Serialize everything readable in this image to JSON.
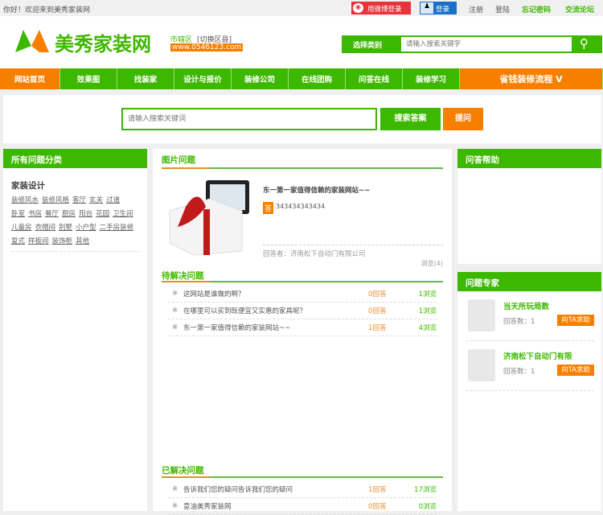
{
  "topbar": {
    "welcome": "你好！欢迎来到美秀家装网",
    "weibo_login": "用微博登录",
    "qq_login": "登录",
    "register": "注册",
    "signin": "登陆",
    "forgot": "忘记密码",
    "forum": "交流论坛"
  },
  "header": {
    "logo": "美秀家装网",
    "city": "市辖区",
    "switch_city": "[切换区县]",
    "url": "www.0546123.com",
    "category_label": "选择类别",
    "search_placeholder": "请输入搜索关键字"
  },
  "nav": [
    "网站首页",
    "效果图",
    "找装家",
    "设计与报价",
    "装修公司",
    "在线团购",
    "问答在线",
    "装修学习"
  ],
  "nav_special": "省钱装修流程 V",
  "search": {
    "placeholder": "请输入搜索关键词",
    "search_btn": "搜索答案",
    "ask_btn": "提问"
  },
  "left": {
    "title": "所有问题分类",
    "group": "家装设计",
    "tags": [
      "装修风水",
      "装修风格",
      "客厅",
      "玄关",
      "过道",
      "卧室",
      "书房",
      "餐厅",
      "厨房",
      "阳台",
      "花园",
      "卫生间",
      "儿童房",
      "衣帽间",
      "别墅",
      "小户型",
      "二手房装修",
      "复式",
      "样板间",
      "装饰柜",
      "其他"
    ]
  },
  "picture": {
    "title": "图片问题",
    "question": "东一第一家值得信赖的家装网站~~",
    "answer_badge": "答",
    "answer": "343434343434",
    "answerer": "回答者：济南松下自动门有限公司",
    "views": "浏览(4)"
  },
  "pending": {
    "title": "待解决问题",
    "rows": [
      {
        "q": "这网站是谁做的啊？",
        "a": "0回答",
        "v": "1浏览"
      },
      {
        "q": "在哪里可以买到既便宜又实惠的家具呢？",
        "a": "0回答",
        "v": "1浏览"
      },
      {
        "q": "东一第一家值得信赖的家装网站~~",
        "a": "1回答",
        "v": "4浏览"
      }
    ]
  },
  "solved": {
    "title": "已解决问题",
    "rows": [
      {
        "q": "告诉我们您的疑问告诉我们您的疑问",
        "a": "1回答",
        "v": "17浏览"
      },
      {
        "q": "意油美秀家装网",
        "a": "0回答",
        "v": "0浏览"
      }
    ]
  },
  "right": {
    "help_title": "问答帮助",
    "experts_title": "问题专家",
    "experts": [
      {
        "name": "当天所玩局数",
        "count": "回答数：1",
        "btn": "向TA求助"
      },
      {
        "name": "济南松下自动门有限",
        "count": "回答数：1",
        "btn": "向TA求助"
      }
    ]
  },
  "mark": "※"
}
